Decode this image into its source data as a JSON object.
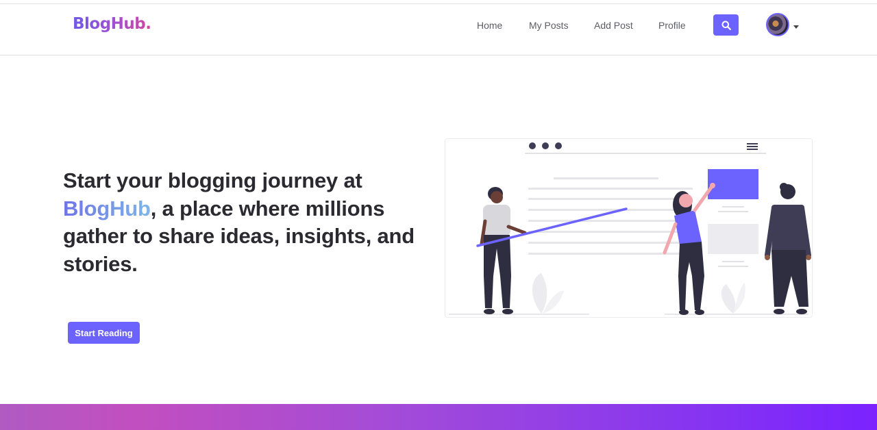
{
  "brand": {
    "name": "BlogHub."
  },
  "nav": {
    "items": [
      {
        "label": "Home"
      },
      {
        "label": "My Posts"
      },
      {
        "label": "Add Post"
      },
      {
        "label": "Profile"
      }
    ],
    "search_icon": "search-icon",
    "avatar_icon": "user-avatar"
  },
  "hero": {
    "title_prefix": "Start your blogging journey at ",
    "title_highlight": "BlogHub",
    "title_suffix": ", a place where millions gather to share ideas, insights, and stories.",
    "cta_label": "Start Reading"
  },
  "colors": {
    "accent": "#6c63ff",
    "brand_gradient_start": "#6f5ae6",
    "brand_gradient_end": "#d2459f",
    "footer_gradient_start": "#c24fbf",
    "footer_gradient_end": "#7b22ff"
  }
}
